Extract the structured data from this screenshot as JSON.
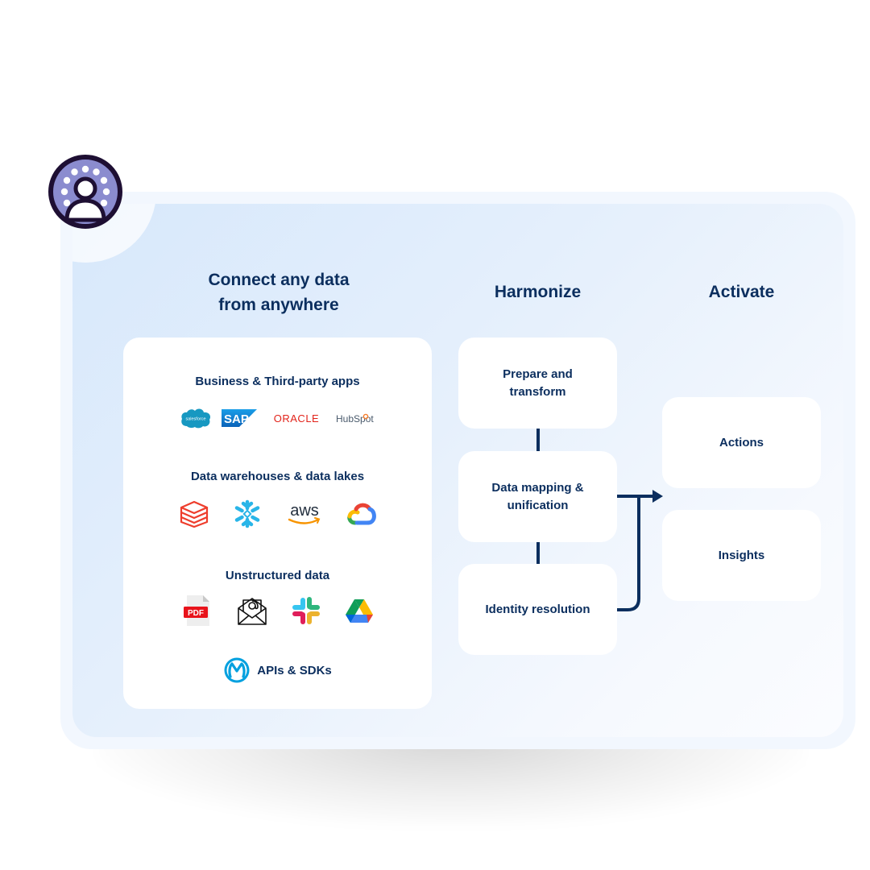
{
  "colors": {
    "text_navy": "#0b2e5e",
    "panel_outer": "#f2f7fe",
    "panel_gradient_start": "#d7e8fb",
    "card_bg": "#ffffff",
    "avatar_fill": "#8b8ccf",
    "avatar_stroke": "#1e0f33"
  },
  "avatar": {
    "icon": "user-circle-icon"
  },
  "columns": {
    "connect": {
      "title_line1": "Connect any data",
      "title_line2": "from anywhere"
    },
    "harmonize": {
      "title": "Harmonize"
    },
    "activate": {
      "title": "Activate"
    }
  },
  "sources": {
    "sections": [
      {
        "title": "Business & Third-party apps",
        "logos": [
          "salesforce",
          "SAP",
          "ORACLE",
          "HubSpot"
        ]
      },
      {
        "title": "Data warehouses & data lakes",
        "logos": [
          "databricks-icon",
          "snowflake-icon",
          "aws",
          "google-cloud-icon"
        ]
      },
      {
        "title": "Unstructured data",
        "logos": [
          "PDF",
          "email-icon",
          "slack-icon",
          "google-drive-icon"
        ]
      }
    ],
    "apis": {
      "label": "APIs & SDKs",
      "icon": "mulesoft-icon"
    }
  },
  "harmonize_steps": [
    {
      "line1": "Prepare and",
      "line2": "transform"
    },
    {
      "line1": "Data mapping &",
      "line2": "unification"
    },
    {
      "line1": "Identity resolution",
      "line2": ""
    }
  ],
  "activate_items": [
    {
      "label": "Actions"
    },
    {
      "label": "Insights"
    }
  ]
}
